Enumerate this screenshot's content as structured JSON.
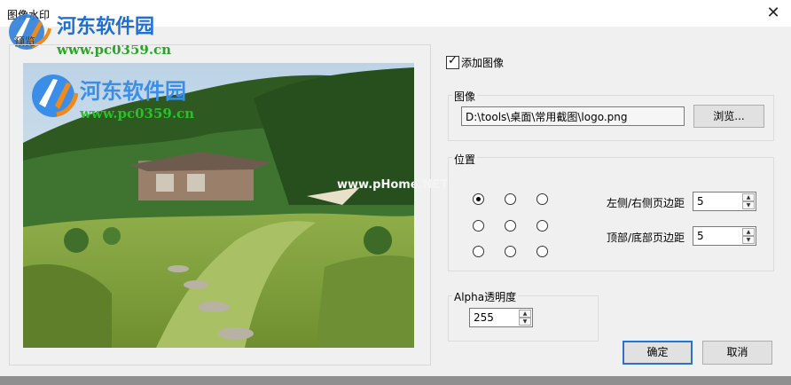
{
  "window": {
    "title": "图像水印",
    "close_glyph": "✕"
  },
  "watermark_overlay": {
    "brand": "河东软件园",
    "url": "www.pc0359.cn"
  },
  "preview": {
    "label": "预览",
    "photo_watermark": {
      "brand": "河东软件园",
      "url": "www.pc0359.cn"
    },
    "site_watermark": "www.pHome.NET"
  },
  "add_image": {
    "checked": true,
    "label": "添加图像",
    "check_glyph": "✓"
  },
  "image_group": {
    "label": "图像",
    "path": "D:\\tools\\桌面\\常用截图\\logo.png",
    "browse_label": "浏览..."
  },
  "position_group": {
    "label": "位置",
    "selected_index": 0,
    "lr_margin_label": "左侧/右侧页边距",
    "lr_margin_value": "5",
    "tb_margin_label": "顶部/底部页边距",
    "tb_margin_value": "5"
  },
  "alpha_group": {
    "label": "Alpha透明度",
    "value": "255"
  },
  "spin_up_glyph": "▲",
  "spin_down_glyph": "▼",
  "buttons": {
    "ok": "确定",
    "cancel": "取消"
  },
  "colors": {
    "accent": "#2b73c9",
    "brand_blue": "#1f6fd1",
    "brand_green": "#2aa52a"
  }
}
